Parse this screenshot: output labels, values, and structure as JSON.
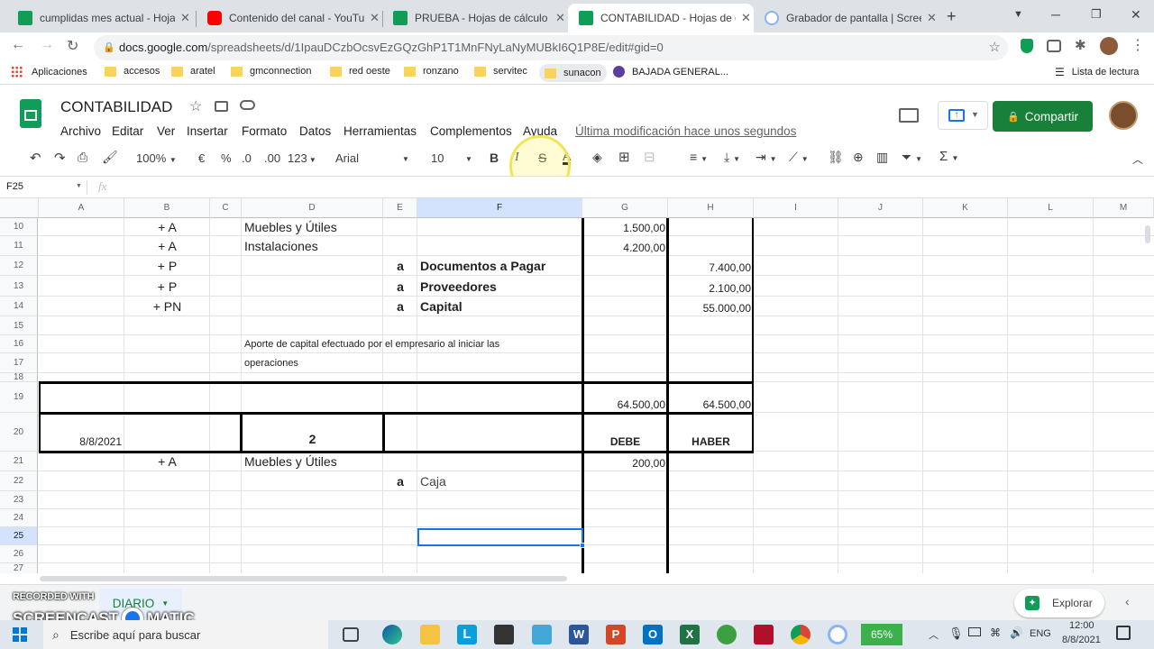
{
  "browser": {
    "tabs": [
      {
        "title": "cumplidas mes actual - Hojas",
        "color": "#0f9d58"
      },
      {
        "title": "Contenido del canal - YouTube",
        "color": "#ff0000"
      },
      {
        "title": "PRUEBA - Hojas de cálculo de",
        "color": "#0f9d58"
      },
      {
        "title": "CONTABILIDAD - Hojas de cá",
        "color": "#0f9d58"
      },
      {
        "title": "Grabador de pantalla | Screen",
        "color": "#8ab4f8"
      }
    ],
    "url_host": "docs.google.com",
    "url_path": "/spreadsheets/d/1IpauDCzbOcsvEzGQzGhP1T1MnFNyLaNyMUBkI6Q1P8E/edit#gid=0",
    "bookmarks": [
      "Aplicaciones",
      "accesos",
      "aratel",
      "gmconnection",
      "red oeste",
      "ronzano",
      "servitec",
      "sunacon",
      "BAJADA GENERAL..."
    ],
    "reading_list": "Lista de lectura"
  },
  "doc": {
    "title": "CONTABILIDAD",
    "menus": [
      "Archivo",
      "Editar",
      "Ver",
      "Insertar",
      "Formato",
      "Datos",
      "Herramientas",
      "Complementos",
      "Ayuda"
    ],
    "last_edit": "Última modificación hace unos segundos",
    "share_label": "Compartir"
  },
  "toolbar": {
    "zoom": "100%",
    "currency": "€",
    "percent": "%",
    "dec_less": ".0",
    "dec_more": ".00",
    "format": "123",
    "font": "Arial",
    "size": "10",
    "bold": "B",
    "italic": "I",
    "strike": "S",
    "textcolor": "A"
  },
  "formula_bar": {
    "cell_ref": "F25",
    "fx": "fx"
  },
  "columns": [
    "A",
    "B",
    "C",
    "D",
    "E",
    "F",
    "G",
    "H",
    "I",
    "J",
    "K",
    "L",
    "M"
  ],
  "rows": [
    "10",
    "11",
    "12",
    "13",
    "14",
    "15",
    "16",
    "17",
    "18",
    "19",
    "20",
    "21",
    "22",
    "23",
    "24",
    "25",
    "26",
    "27"
  ],
  "cells": {
    "r10": {
      "b": "+ A",
      "d": "Muebles y Útiles",
      "g": "1.500,00"
    },
    "r11": {
      "b": "+ A",
      "d": "Instalaciones",
      "g": "4.200,00"
    },
    "r12": {
      "b": "+ P",
      "e": "a",
      "f": "Documentos a Pagar",
      "h": "7.400,00"
    },
    "r13": {
      "b": "+ P",
      "e": "a",
      "f": "Proveedores",
      "h": "2.100,00"
    },
    "r14": {
      "b": "+ PN",
      "e": "a",
      "f": "Capital",
      "h": "55.000,00"
    },
    "r16": {
      "d": "Aporte de capital efectuado por el empresario al iniciar las"
    },
    "r17": {
      "d": "operaciones"
    },
    "r19": {
      "g": "64.500,00",
      "h": "64.500,00"
    },
    "r20": {
      "a": "8/8/2021",
      "d": "2",
      "g": "DEBE",
      "h": "HABER"
    },
    "r21": {
      "b": "+ A",
      "d": "Muebles y Útiles",
      "g": "200,00"
    },
    "r22": {
      "e": "a",
      "f": "Caja"
    }
  },
  "sheet": {
    "tab": "DIARIO",
    "explore": "Explorar"
  },
  "watermark": {
    "line1": "RECORDED WITH",
    "line2": "SCREENCAST",
    "line3": "MATIC"
  },
  "taskbar": {
    "search": "Escribe aquí para buscar",
    "battery": "65%",
    "lang": "ENG",
    "time": "12:00",
    "date": "8/8/2021"
  }
}
